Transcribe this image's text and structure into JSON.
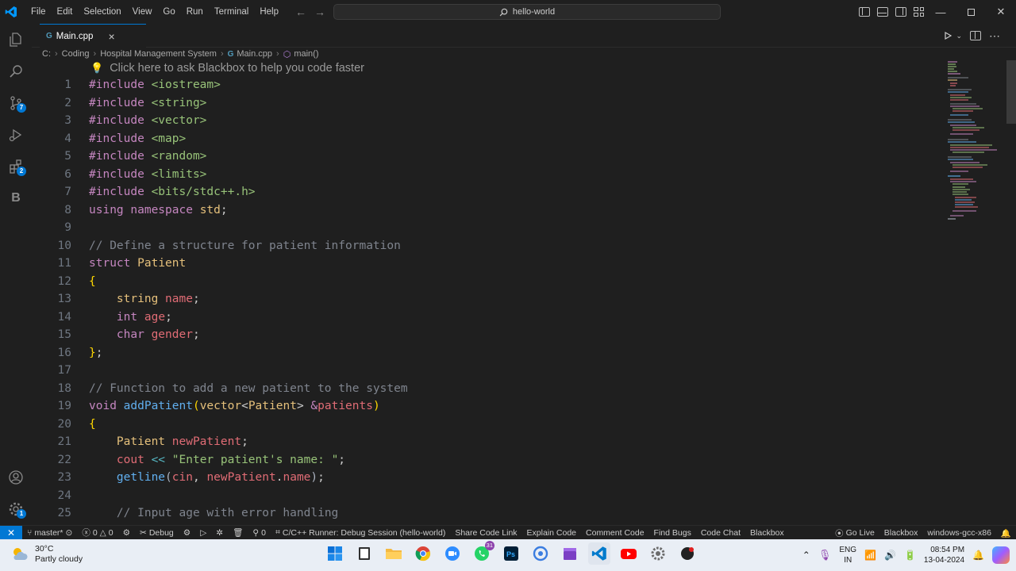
{
  "titlebar": {
    "menu": [
      "File",
      "Edit",
      "Selection",
      "View",
      "Go",
      "Run",
      "Terminal",
      "Help"
    ],
    "search_text": "hello-world",
    "search_icon": "search-icon"
  },
  "activitybar": {
    "items": [
      {
        "icon": "explorer-icon"
      },
      {
        "icon": "search-icon"
      },
      {
        "icon": "source-control-icon",
        "badge": "7"
      },
      {
        "icon": "run-debug-icon"
      },
      {
        "icon": "extensions-icon",
        "badge": "2"
      },
      {
        "icon": "blackbox-icon",
        "label": "B"
      }
    ],
    "bottom": [
      {
        "icon": "account-icon"
      },
      {
        "icon": "manage-gear-icon",
        "badge": "1"
      }
    ]
  },
  "tabs": [
    {
      "label": "Main.cpp",
      "icon_text": "G",
      "active": true
    }
  ],
  "breadcrumb": {
    "drive": "C:",
    "folder1": "Coding",
    "folder2": "Hospital Management System",
    "file": "Main.cpp",
    "symbol": "main()"
  },
  "editor": {
    "hint": "Click here to ask Blackbox to help you code faster",
    "line_numbers": [
      "1",
      "2",
      "3",
      "4",
      "5",
      "6",
      "7",
      "8",
      "9",
      "10",
      "11",
      "12",
      "13",
      "14",
      "15",
      "16",
      "17",
      "18",
      "19",
      "20",
      "21",
      "22",
      "23",
      "24",
      "25"
    ]
  },
  "statusbar": {
    "branch": "master*",
    "errors": "0",
    "warnings": "0",
    "debug": "Debug",
    "ports": "0",
    "runner": "C/C++ Runner: Debug Session (hello-world)",
    "share": "Share Code Link",
    "explain": "Explain Code",
    "comment": "Comment Code",
    "bugs": "Find Bugs",
    "chat": "Code Chat",
    "blackbox": "Blackbox",
    "golive": "Go Live",
    "blackbox2": "Blackbox",
    "compiler": "windows-gcc-x86"
  },
  "taskbar": {
    "temperature": "30°C",
    "weather": "Partly cloudy",
    "apps": [
      "windows-start-icon",
      "file-manager-icon",
      "folder-icon",
      "chrome-icon",
      "zoom-icon",
      "whatsapp-icon",
      "photoshop-icon",
      "app-blue-icon",
      "clapper-icon",
      "vscode-icon",
      "youtube-icon",
      "settings-icon",
      "app-dark-icon"
    ],
    "whatsapp_badge": "31",
    "lang1": "ENG",
    "lang2": "IN",
    "time": "08:54 PM",
    "date": "13-04-2024"
  },
  "colors": {
    "accent": "#0078d4",
    "editor_bg": "#1f1f1f",
    "keyword": "#c586c0",
    "type": "#e5c07b",
    "string": "#98c379",
    "comment": "#7f848e",
    "variable": "#e06c75",
    "function": "#61afef"
  }
}
